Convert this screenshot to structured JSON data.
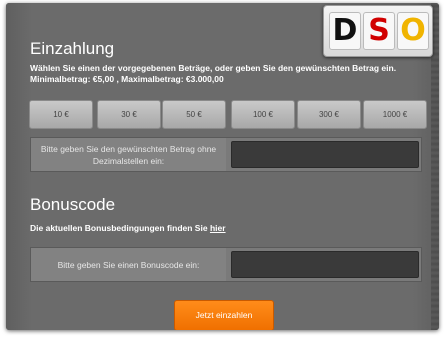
{
  "logo": {
    "letters": [
      "D",
      "S",
      "O"
    ]
  },
  "deposit": {
    "title": "Einzahlung",
    "instructions_line1": "Wählen Sie einen der vorgegebenen Beträge, oder geben Sie den gewünschten Betrag ein.",
    "instructions_line2": "Minimalbetrag: €5,00 , Maximalbetrag: €3.000,00",
    "amounts": [
      "10 €",
      "30 €",
      "50 €",
      "100 €",
      "300 €",
      "1000 €"
    ],
    "custom_label": "Bitte geben Sie den gewünschten Betrag ohne Dezimalstellen ein:",
    "custom_value": ""
  },
  "bonus": {
    "title": "Bonuscode",
    "terms_text": "Die aktuellen Bonusbedingungen finden Sie",
    "terms_link": "hier",
    "code_label": "Bitte geben Sie einen Bonuscode ein:",
    "code_value": ""
  },
  "submit_label": "Jetzt einzahlen",
  "colors": {
    "accent": "#f07000",
    "panel": "#6a6a6a",
    "input": "#3a3a3a"
  }
}
